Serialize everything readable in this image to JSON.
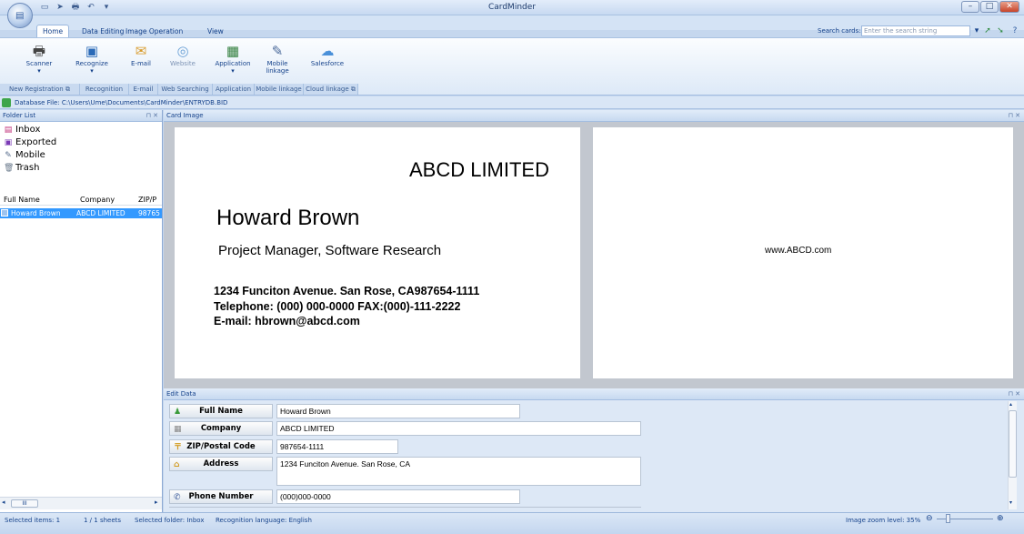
{
  "window": {
    "title": "CardMinder",
    "min_icon": "minimize-icon",
    "max_icon": "maximize-icon",
    "close_icon": "close-icon"
  },
  "qat": [
    "new-icon",
    "pointer-icon",
    "scanner-icon",
    "undo-icon"
  ],
  "tabs": [
    "Home",
    "Data Editing",
    "Image Operation",
    "View"
  ],
  "search": {
    "label": "Search cards:",
    "placeholder": "Enter the search string"
  },
  "ribbon": {
    "buttons": [
      {
        "label": "Scanner",
        "sub": "▾",
        "icon": "scanner-icon"
      },
      {
        "label": "Recognize",
        "sub": "▾",
        "icon": "recognize-icon"
      },
      {
        "label": "E-mail",
        "sub": "",
        "icon": "email-icon"
      },
      {
        "label": "Website",
        "sub": "",
        "icon": "website-icon"
      },
      {
        "label": "Application",
        "sub": "▾",
        "icon": "application-icon"
      },
      {
        "label": "Mobile",
        "sub": "linkage",
        "icon": "mobile-icon"
      },
      {
        "label": "Salesforce",
        "sub": "",
        "icon": "salesforce-icon"
      }
    ],
    "groups": [
      "New Registration",
      "Recognition",
      "E-mail",
      "Web Searching",
      "Application",
      "Mobile linkage",
      "Cloud linkage"
    ]
  },
  "dbfile": "Database File: C:\\Users\\Ume\\Documents\\CardMinder\\ENTRYDB.BID",
  "folder_list": {
    "title": "Folder List",
    "folders": [
      {
        "label": "Inbox",
        "icon": "inbox-icon"
      },
      {
        "label": "Exported",
        "icon": "exported-icon"
      },
      {
        "label": "Mobile",
        "icon": "mobile-icon"
      },
      {
        "label": "Trash",
        "icon": "trash-icon"
      }
    ],
    "columns": [
      "Full Name",
      "Company",
      "ZIP/P"
    ],
    "rows": [
      [
        "Howard Brown",
        "ABCD LIMITED",
        "98765"
      ]
    ]
  },
  "card_image": {
    "title": "Card Image",
    "front": {
      "company": "ABCD LIMITED",
      "name": "Howard Brown",
      "position": "Project Manager, Software Research",
      "address": "1234 Funciton Avenue. San Rose, CA987654-1111",
      "phone": "Telephone: (000) 000-0000  FAX:(000)-111-2222",
      "email": "E-mail: hbrown@abcd.com"
    },
    "back": {
      "website": "www.ABCD.com"
    }
  },
  "edit_data": {
    "title": "Edit Data",
    "fields": [
      {
        "label": "Full Name",
        "value": "Howard Brown",
        "icon": "person-icon"
      },
      {
        "label": "Company",
        "value": "ABCD LIMITED",
        "icon": "building-icon"
      },
      {
        "label": "ZIP/Postal Code",
        "value": "987654-1111",
        "icon": "postal-icon"
      },
      {
        "label": "Address",
        "value": "1234 Funciton Avenue. San Rose, CA",
        "icon": "address-icon"
      },
      {
        "label": "Phone Number",
        "value": "(000)000-0000",
        "icon": "phone-icon"
      }
    ]
  },
  "status": {
    "selected_items": "Selected items:   1",
    "sheets": "1 / 1 sheets",
    "selected_folder": "Selected folder: Inbox",
    "recognition_lang": "Recognition language: English",
    "zoom": "Image zoom level: 35%"
  }
}
